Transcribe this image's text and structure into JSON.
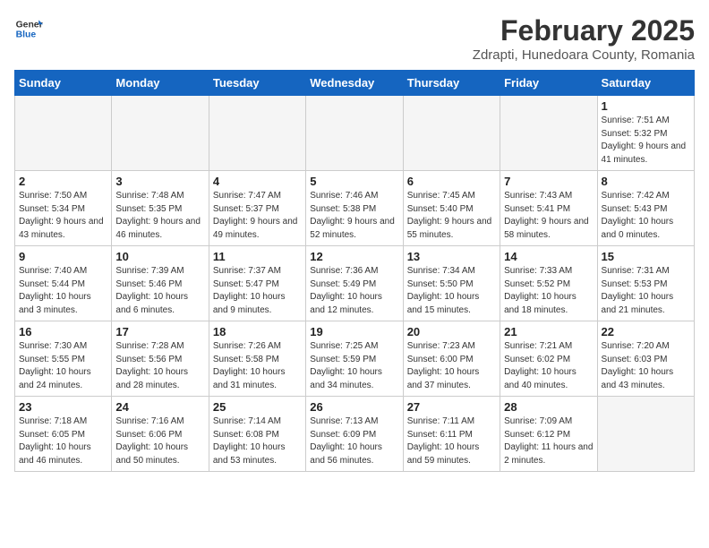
{
  "logo": {
    "line1": "General",
    "line2": "Blue"
  },
  "title": "February 2025",
  "subtitle": "Zdrapti, Hunedoara County, Romania",
  "weekdays": [
    "Sunday",
    "Monday",
    "Tuesday",
    "Wednesday",
    "Thursday",
    "Friday",
    "Saturday"
  ],
  "weeks": [
    [
      {
        "day": "",
        "detail": ""
      },
      {
        "day": "",
        "detail": ""
      },
      {
        "day": "",
        "detail": ""
      },
      {
        "day": "",
        "detail": ""
      },
      {
        "day": "",
        "detail": ""
      },
      {
        "day": "",
        "detail": ""
      },
      {
        "day": "1",
        "detail": "Sunrise: 7:51 AM\nSunset: 5:32 PM\nDaylight: 9 hours and 41 minutes."
      }
    ],
    [
      {
        "day": "2",
        "detail": "Sunrise: 7:50 AM\nSunset: 5:34 PM\nDaylight: 9 hours and 43 minutes."
      },
      {
        "day": "3",
        "detail": "Sunrise: 7:48 AM\nSunset: 5:35 PM\nDaylight: 9 hours and 46 minutes."
      },
      {
        "day": "4",
        "detail": "Sunrise: 7:47 AM\nSunset: 5:37 PM\nDaylight: 9 hours and 49 minutes."
      },
      {
        "day": "5",
        "detail": "Sunrise: 7:46 AM\nSunset: 5:38 PM\nDaylight: 9 hours and 52 minutes."
      },
      {
        "day": "6",
        "detail": "Sunrise: 7:45 AM\nSunset: 5:40 PM\nDaylight: 9 hours and 55 minutes."
      },
      {
        "day": "7",
        "detail": "Sunrise: 7:43 AM\nSunset: 5:41 PM\nDaylight: 9 hours and 58 minutes."
      },
      {
        "day": "8",
        "detail": "Sunrise: 7:42 AM\nSunset: 5:43 PM\nDaylight: 10 hours and 0 minutes."
      }
    ],
    [
      {
        "day": "9",
        "detail": "Sunrise: 7:40 AM\nSunset: 5:44 PM\nDaylight: 10 hours and 3 minutes."
      },
      {
        "day": "10",
        "detail": "Sunrise: 7:39 AM\nSunset: 5:46 PM\nDaylight: 10 hours and 6 minutes."
      },
      {
        "day": "11",
        "detail": "Sunrise: 7:37 AM\nSunset: 5:47 PM\nDaylight: 10 hours and 9 minutes."
      },
      {
        "day": "12",
        "detail": "Sunrise: 7:36 AM\nSunset: 5:49 PM\nDaylight: 10 hours and 12 minutes."
      },
      {
        "day": "13",
        "detail": "Sunrise: 7:34 AM\nSunset: 5:50 PM\nDaylight: 10 hours and 15 minutes."
      },
      {
        "day": "14",
        "detail": "Sunrise: 7:33 AM\nSunset: 5:52 PM\nDaylight: 10 hours and 18 minutes."
      },
      {
        "day": "15",
        "detail": "Sunrise: 7:31 AM\nSunset: 5:53 PM\nDaylight: 10 hours and 21 minutes."
      }
    ],
    [
      {
        "day": "16",
        "detail": "Sunrise: 7:30 AM\nSunset: 5:55 PM\nDaylight: 10 hours and 24 minutes."
      },
      {
        "day": "17",
        "detail": "Sunrise: 7:28 AM\nSunset: 5:56 PM\nDaylight: 10 hours and 28 minutes."
      },
      {
        "day": "18",
        "detail": "Sunrise: 7:26 AM\nSunset: 5:58 PM\nDaylight: 10 hours and 31 minutes."
      },
      {
        "day": "19",
        "detail": "Sunrise: 7:25 AM\nSunset: 5:59 PM\nDaylight: 10 hours and 34 minutes."
      },
      {
        "day": "20",
        "detail": "Sunrise: 7:23 AM\nSunset: 6:00 PM\nDaylight: 10 hours and 37 minutes."
      },
      {
        "day": "21",
        "detail": "Sunrise: 7:21 AM\nSunset: 6:02 PM\nDaylight: 10 hours and 40 minutes."
      },
      {
        "day": "22",
        "detail": "Sunrise: 7:20 AM\nSunset: 6:03 PM\nDaylight: 10 hours and 43 minutes."
      }
    ],
    [
      {
        "day": "23",
        "detail": "Sunrise: 7:18 AM\nSunset: 6:05 PM\nDaylight: 10 hours and 46 minutes."
      },
      {
        "day": "24",
        "detail": "Sunrise: 7:16 AM\nSunset: 6:06 PM\nDaylight: 10 hours and 50 minutes."
      },
      {
        "day": "25",
        "detail": "Sunrise: 7:14 AM\nSunset: 6:08 PM\nDaylight: 10 hours and 53 minutes."
      },
      {
        "day": "26",
        "detail": "Sunrise: 7:13 AM\nSunset: 6:09 PM\nDaylight: 10 hours and 56 minutes."
      },
      {
        "day": "27",
        "detail": "Sunrise: 7:11 AM\nSunset: 6:11 PM\nDaylight: 10 hours and 59 minutes."
      },
      {
        "day": "28",
        "detail": "Sunrise: 7:09 AM\nSunset: 6:12 PM\nDaylight: 11 hours and 2 minutes."
      },
      {
        "day": "",
        "detail": ""
      }
    ]
  ]
}
